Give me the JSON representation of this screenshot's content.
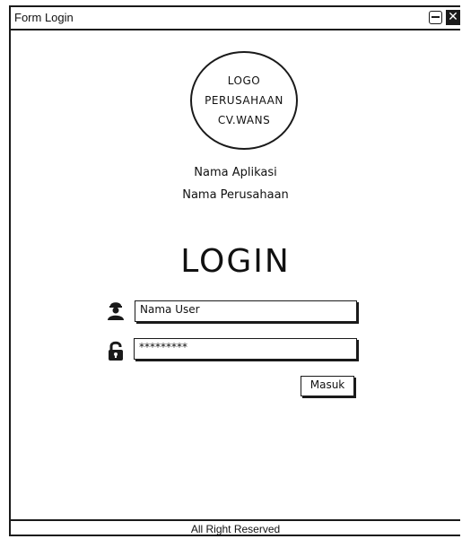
{
  "window": {
    "title": "Form Login"
  },
  "logo": {
    "lines": [
      "LOGO",
      "PERUSAHAAN",
      "CV.WANS"
    ]
  },
  "app_name": "Nama Aplikasi",
  "company_name": "Nama Perusahaan",
  "login": {
    "heading": "LOGIN",
    "username_value": "Nama User",
    "password_value": "*********",
    "submit_label": "Masuk"
  },
  "footer": {
    "text": "All Right Reserved"
  },
  "icons": {
    "user": "user-worker-icon",
    "lock": "lock-icon",
    "minimize": "minimize-icon",
    "close": "close-icon"
  }
}
